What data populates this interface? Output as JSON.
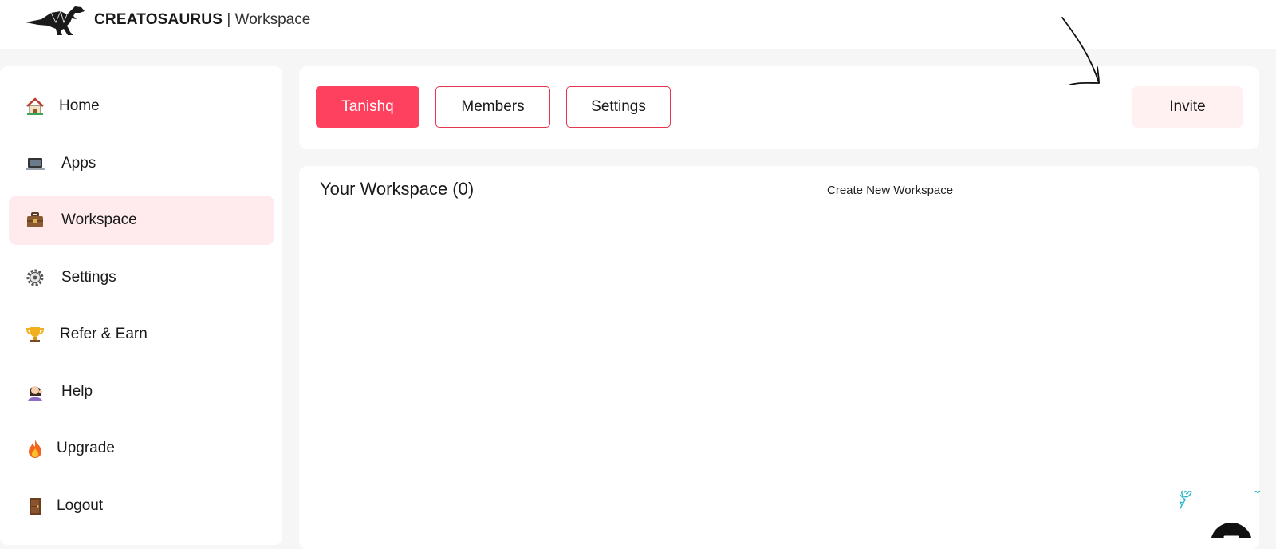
{
  "brand": {
    "name": "CREATOSAURUS",
    "separator": "|",
    "section": "Workspace"
  },
  "sidebar": {
    "items": [
      {
        "label": "Home",
        "icon": "house-icon",
        "active": false
      },
      {
        "label": "Apps",
        "icon": "laptop-icon",
        "active": false
      },
      {
        "label": "Workspace",
        "icon": "briefcase-icon",
        "active": true
      },
      {
        "label": "Settings",
        "icon": "gear-icon",
        "active": false
      },
      {
        "label": "Refer & Earn",
        "icon": "trophy-icon",
        "active": false
      },
      {
        "label": "Help",
        "icon": "person-tipping-hand-icon",
        "active": false
      },
      {
        "label": "Upgrade",
        "icon": "fire-icon",
        "active": false
      },
      {
        "label": "Logout",
        "icon": "door-icon",
        "active": false
      }
    ]
  },
  "tabs": {
    "workspace_name": "Tanishq",
    "members": "Members",
    "settings": "Settings",
    "invite": "Invite"
  },
  "workspace": {
    "title": "Your Workspace (0)",
    "create_link": "Create New Workspace"
  },
  "help_badge": {
    "text": "We Are Here!"
  },
  "colors": {
    "accent": "#ff4160",
    "active_bg": "#ffebee",
    "invite_bg": "#fff0f2",
    "page_bg": "#f6f6f6",
    "badge_text": "#2fb8c9"
  }
}
